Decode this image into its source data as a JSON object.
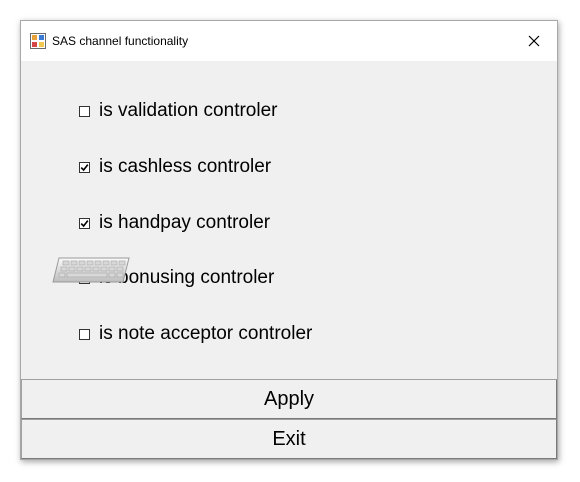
{
  "window": {
    "title": "SAS channel functionality"
  },
  "options": [
    {
      "label": "is validation controler",
      "checked": false
    },
    {
      "label": "is cashless controler",
      "checked": true
    },
    {
      "label": "is handpay controler",
      "checked": true
    },
    {
      "label": "is bonusing controler",
      "checked": false
    },
    {
      "label": "is note acceptor controler",
      "checked": false
    }
  ],
  "buttons": {
    "apply_label": "Apply",
    "exit_label": "Exit"
  },
  "icons": {
    "app": "app-window-icon",
    "close": "close-icon",
    "keyboard": "keyboard-icon"
  },
  "colors": {
    "window_bg": "#f0f0f0",
    "titlebar_bg": "#ffffff",
    "text": "#000000"
  }
}
